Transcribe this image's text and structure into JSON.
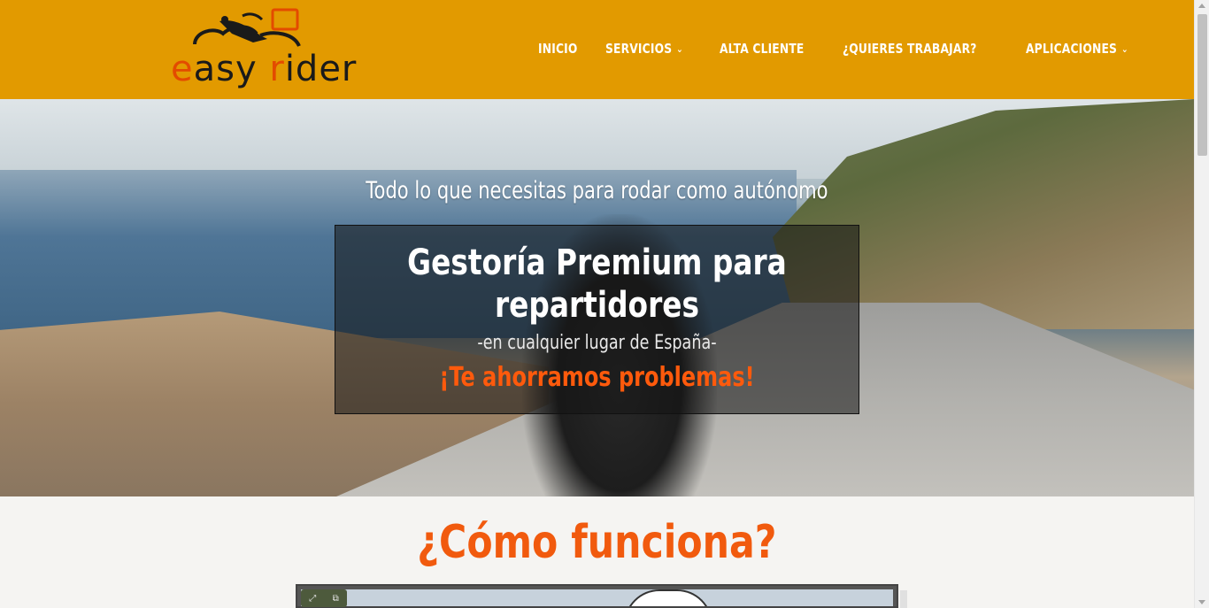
{
  "brand": {
    "logo_part1": "e",
    "logo_part2": "asy ",
    "logo_part3": "r",
    "logo_part4": "ider",
    "logo_icon": "motorcycle-icon"
  },
  "nav": {
    "items": [
      {
        "label": "INICIO",
        "has_dropdown": false
      },
      {
        "label": "SERVICIOS",
        "has_dropdown": true
      },
      {
        "label": "ALTA CLIENTE",
        "has_dropdown": false
      },
      {
        "label": "¿QUIERES TRABAJAR?",
        "has_dropdown": false
      },
      {
        "label": "APLICACIONES",
        "has_dropdown": true
      }
    ],
    "dropdown_icon": "chevron-down-icon"
  },
  "hero": {
    "tagline": "Todo lo que necesitas para rodar como autónomo",
    "title": "Gestoría Premium para repartidores",
    "subtitle": "-en cualquier lugar de España-",
    "cta": "¡Te ahorramos problemas!"
  },
  "section": {
    "title": "¿Cómo funciona?"
  },
  "video": {
    "controls": [
      "expand-icon",
      "picture-in-picture-icon"
    ]
  },
  "colors": {
    "header_bg": "#e29a00",
    "accent_orange": "#f15a0e",
    "cta_orange": "#ff5a0c",
    "page_bg": "#f5f4f2"
  }
}
